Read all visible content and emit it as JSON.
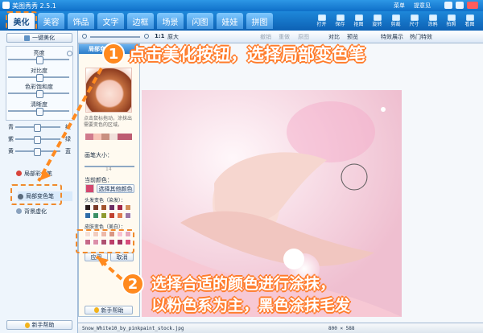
{
  "app": {
    "title": "美图秀秀 2.5.1"
  },
  "window_controls": {
    "menu": "菜单",
    "tips": "提意见"
  },
  "tabs": [
    "美化",
    "美容",
    "饰品",
    "文字",
    "边框",
    "场景",
    "闪图",
    "娃娃",
    "拼图"
  ],
  "toolbar_right": [
    "打开",
    "保存",
    "抠图",
    "旋转",
    "剪裁",
    "尺寸",
    "涂鸦",
    "拍照",
    "看图"
  ],
  "left_panel": {
    "one_key": "一键美化",
    "adjustments": [
      "亮度",
      "对比度",
      "色彩饱和度",
      "清晰度"
    ],
    "color_pairs": [
      {
        "left": "青",
        "right": "红"
      },
      {
        "left": "紫",
        "right": "绿"
      },
      {
        "left": "黄",
        "right": "蓝"
      }
    ],
    "tools": [
      "局部彩色笔",
      "局部变色笔",
      "背景虚化"
    ],
    "help": "新手帮助"
  },
  "topbar": {
    "zoom": "1:1",
    "original": "原大",
    "actions": [
      "撤销",
      "重做",
      "原图",
      "对比",
      "预览"
    ],
    "effects": "特效展示",
    "hot": "热门特效"
  },
  "subpanel": {
    "title": "局部变色笔",
    "desc": "点击鼠标拖动，涂抹出需要变色的区域。",
    "brush": "画笔大小：",
    "brush_value": "14",
    "color_label": "当前颜色：",
    "choose": "选择其他颜色",
    "hair": "头发变色（染发）：",
    "skin": "皮肤变色（美白）：",
    "apply": "应用",
    "cancel": "取消",
    "help": "新手帮助"
  },
  "annotations": {
    "step1_num": "1",
    "step1": "点击美化按钮，选择局部变色笔",
    "step2_num": "2",
    "step2_line1": "选择合适的颜色进行涂抹，",
    "step2_line2": "以粉色系为主，黑色涂抹毛发"
  },
  "status": {
    "filename": "Snow_White10_by_pinkpaint_stock.jpg",
    "size": "800 × 588"
  },
  "colors": {
    "accent_orange": "#ff8a1f",
    "brand_blue": "#0f66b8",
    "pink": "#f3a8c7"
  }
}
